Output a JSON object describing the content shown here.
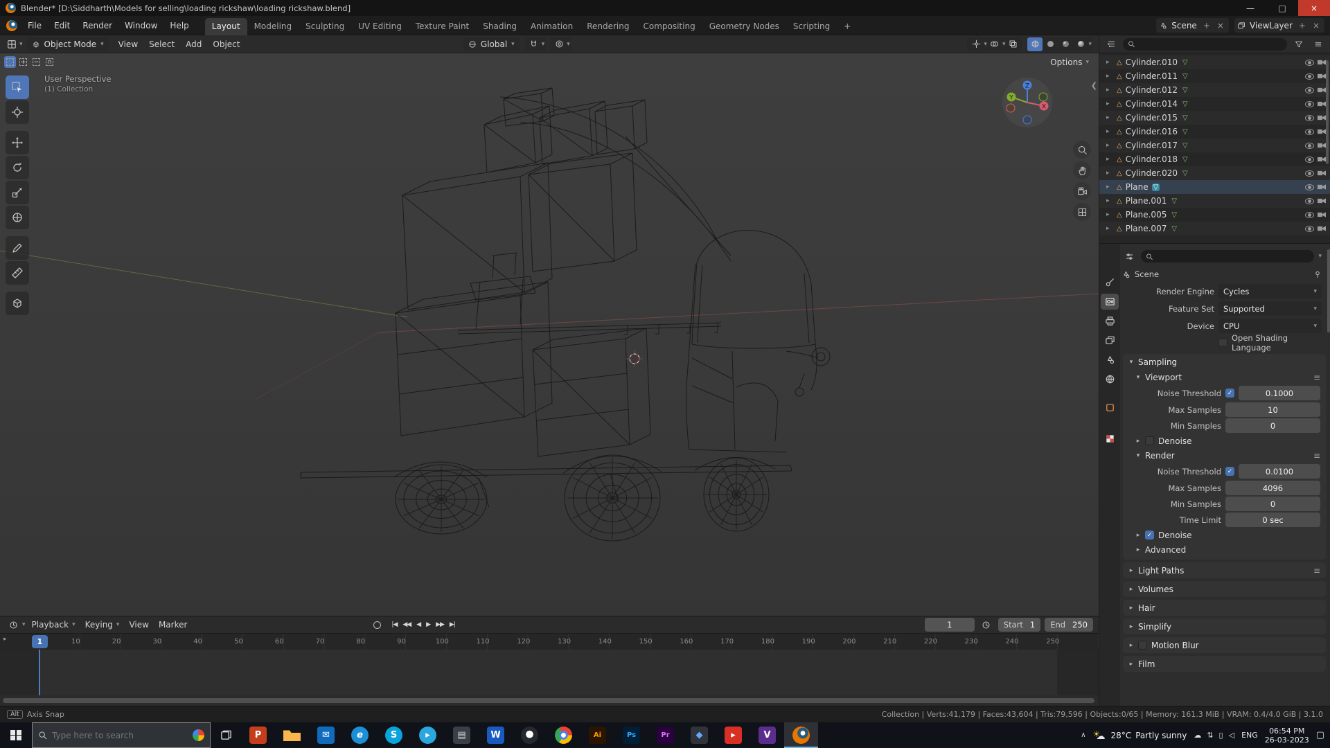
{
  "window": {
    "title": "Blender* [D:\\Siddharth\\Models for selling\\loading rickshaw\\loading rickshaw.blend]",
    "controls": {
      "minimize": "—",
      "maximize": "□",
      "close": "×"
    }
  },
  "topbar": {
    "menus": [
      "File",
      "Edit",
      "Render",
      "Window",
      "Help"
    ],
    "workspaces": [
      {
        "label": "Layout",
        "active": true
      },
      {
        "label": "Modeling"
      },
      {
        "label": "Sculpting"
      },
      {
        "label": "UV Editing"
      },
      {
        "label": "Texture Paint"
      },
      {
        "label": "Shading"
      },
      {
        "label": "Animation"
      },
      {
        "label": "Rendering"
      },
      {
        "label": "Compositing"
      },
      {
        "label": "Geometry Nodes"
      },
      {
        "label": "Scripting"
      },
      {
        "label": "+"
      }
    ],
    "scene_selector": {
      "label": "Scene",
      "new_icon": "+",
      "unlink_icon": "×"
    },
    "viewlayer_selector": {
      "label": "ViewLayer",
      "new_icon": "+",
      "unlink_icon": "×"
    }
  },
  "viewport_header": {
    "mode": "Object Mode",
    "menus": [
      "View",
      "Select",
      "Add",
      "Object"
    ],
    "orientation": "Global",
    "options_label": "Options"
  },
  "viewport_overlay": {
    "perspective_label": "User Perspective",
    "collection_label": "(1) Collection",
    "axis_labels": {
      "x": "X",
      "y": "Y",
      "z": "Z"
    }
  },
  "outliner": {
    "items": [
      {
        "name": "Cylinder.010"
      },
      {
        "name": "Cylinder.011"
      },
      {
        "name": "Cylinder.012"
      },
      {
        "name": "Cylinder.014"
      },
      {
        "name": "Cylinder.015"
      },
      {
        "name": "Cylinder.016"
      },
      {
        "name": "Cylinder.017"
      },
      {
        "name": "Cylinder.018"
      },
      {
        "name": "Cylinder.020"
      },
      {
        "name": "Plane",
        "active": true
      },
      {
        "name": "Plane.001"
      },
      {
        "name": "Plane.005"
      },
      {
        "name": "Plane.007"
      }
    ]
  },
  "properties": {
    "breadcrumb": "Scene",
    "render_engine": {
      "label": "Render Engine",
      "value": "Cycles"
    },
    "feature_set": {
      "label": "Feature Set",
      "value": "Supported"
    },
    "device": {
      "label": "Device",
      "value": "CPU"
    },
    "osl": {
      "label": "Open Shading Language",
      "checked": false
    },
    "sampling": {
      "title": "Sampling",
      "viewport": {
        "title": "Viewport",
        "noise_threshold": {
          "label": "Noise Threshold",
          "checked": true,
          "value": "0.1000"
        },
        "max_samples": {
          "label": "Max Samples",
          "value": "10"
        },
        "min_samples": {
          "label": "Min Samples",
          "value": "0"
        },
        "denoise": {
          "label": "Denoise",
          "checked": false
        }
      },
      "render": {
        "title": "Render",
        "noise_threshold": {
          "label": "Noise Threshold",
          "checked": true,
          "value": "0.0100"
        },
        "max_samples": {
          "label": "Max Samples",
          "value": "4096"
        },
        "min_samples": {
          "label": "Min Samples",
          "value": "0"
        },
        "time_limit": {
          "label": "Time Limit",
          "value": "0 sec"
        },
        "denoise": {
          "label": "Denoise",
          "checked": true
        }
      },
      "advanced_label": "Advanced"
    },
    "collapsed_sections": [
      {
        "title": "Light Paths",
        "preset": true
      },
      {
        "title": "Volumes"
      },
      {
        "title": "Hair"
      },
      {
        "title": "Simplify"
      },
      {
        "title": "Motion Blur",
        "checkbox": true
      },
      {
        "title": "Film"
      }
    ]
  },
  "timeline": {
    "menus": [
      {
        "label": "Playback",
        "chevron": true
      },
      {
        "label": "Keying",
        "chevron": true
      },
      {
        "label": "View"
      },
      {
        "label": "Marker"
      }
    ],
    "transport": [
      {
        "name": "jump-to-start-icon",
        "glyph": "|◀"
      },
      {
        "name": "prev-keyframe-icon",
        "glyph": "◀◀"
      },
      {
        "name": "play-reverse-icon",
        "glyph": "◀"
      },
      {
        "name": "play-icon",
        "glyph": "▶"
      },
      {
        "name": "next-keyframe-icon",
        "glyph": "▶▶"
      },
      {
        "name": "jump-to-end-icon",
        "glyph": "▶|"
      }
    ],
    "current_frame": "1",
    "playhead_label": "1",
    "start": {
      "label": "Start",
      "value": "1"
    },
    "end": {
      "label": "End",
      "value": "250"
    },
    "ruler": [
      "10",
      "20",
      "30",
      "40",
      "50",
      "60",
      "70",
      "80",
      "90",
      "100",
      "110",
      "120",
      "130",
      "140",
      "150",
      "160",
      "170",
      "180",
      "190",
      "200",
      "210",
      "220",
      "230",
      "240",
      "250"
    ]
  },
  "statusbar": {
    "hint_key": "Alt",
    "hint_text": "Axis Snap",
    "stats": "Collection | Verts:41,179 | Faces:43,604 | Tris:79,596 | Objects:0/65 | Memory: 161.3 MiB | VRAM: 0.4/4.0 GiB | 3.1.0"
  },
  "taskbar": {
    "search_placeholder": "Type here to search",
    "apps": [
      {
        "name": "powerpoint-icon",
        "glyph": "P",
        "style": "background:#c43e1c;color:#fff"
      },
      {
        "name": "file-explorer-icon",
        "glyph": "",
        "style": "background:#f8b64c;clip-path:polygon(0 22%,36% 22%,46% 36%,100% 36%,100% 84%,0 84%)"
      },
      {
        "name": "mail-app-icon",
        "glyph": "✉",
        "style": "background:#0f6cbd;color:#fff;font-weight:normal"
      },
      {
        "name": "edge-legacy-icon",
        "glyph": "e",
        "style": "background:#1c8fd6;color:#fff;border-radius:50%;font-style:italic"
      },
      {
        "name": "skype-icon",
        "glyph": "S",
        "style": "background:#0aa4dc;color:#fff;border-radius:50%"
      },
      {
        "name": "telegram-icon",
        "glyph": "▸",
        "style": "background:#2aa7de;color:#fff;border-radius:50%"
      },
      {
        "name": "notes-app-icon",
        "glyph": "▤",
        "style": "background:#3a3f45;color:#cdd6df"
      },
      {
        "name": "word-icon",
        "glyph": "W",
        "style": "background:#185abd;color:#fff"
      },
      {
        "name": "github-desktop-icon",
        "glyph": "",
        "style": "background:radial-gradient(circle at 50% 45%,#fff 0 28%,#24292f 29% 100%);border-radius:50%"
      },
      {
        "name": "chrome-icon",
        "glyph": "",
        "style": "border-radius:50%;background:radial-gradient(circle at 50% 50%,#fff 0 19%,#4285f4 19% 36%,transparent 36%),conic-gradient(from -30deg,#ea4335 0 120deg,#fbbc05 120deg 240deg,#34a853 240deg 360deg)"
      },
      {
        "name": "illustrator-icon",
        "glyph": "Ai",
        "style": "background:#2a1500;color:#ff9a00;font-size:10px"
      },
      {
        "name": "photoshop-icon",
        "glyph": "Ps",
        "style": "background:#001e36;color:#31a8ff;font-size:10px"
      },
      {
        "name": "premiere-icon",
        "glyph": "Pr",
        "style": "background:#2a003f;color:#d977f5;font-size:10px"
      },
      {
        "name": "drive-app-icon",
        "glyph": "◆",
        "style": "background:#30343a;color:#62a8ff"
      },
      {
        "name": "media-red-app-icon",
        "glyph": "▸",
        "style": "background:#d93025;color:#fff"
      },
      {
        "name": "v-app-icon",
        "glyph": "V",
        "style": "background:#5b2d8e;color:#fff"
      },
      {
        "name": "blender-icon",
        "glyph": "",
        "active": true,
        "style": "border-radius:50%;background:radial-gradient(circle at 60% 38%,#fff 0 15%,#2a5a7a 16% 36%,#ea7600 37% 100%)"
      }
    ],
    "tray": {
      "chevron": "∧",
      "weather_temp": "28°C",
      "weather_desc": "Partly sunny",
      "icons": [
        {
          "name": "onedrive-icon",
          "glyph": "☁"
        },
        {
          "name": "network-icon",
          "glyph": "⇅"
        },
        {
          "name": "battery-icon",
          "glyph": "▯"
        },
        {
          "name": "volume-icon",
          "glyph": "◁"
        }
      ],
      "lang": "ENG",
      "time": "06:54 PM",
      "date": "26-03-2023",
      "notification_icon": "▢"
    }
  }
}
